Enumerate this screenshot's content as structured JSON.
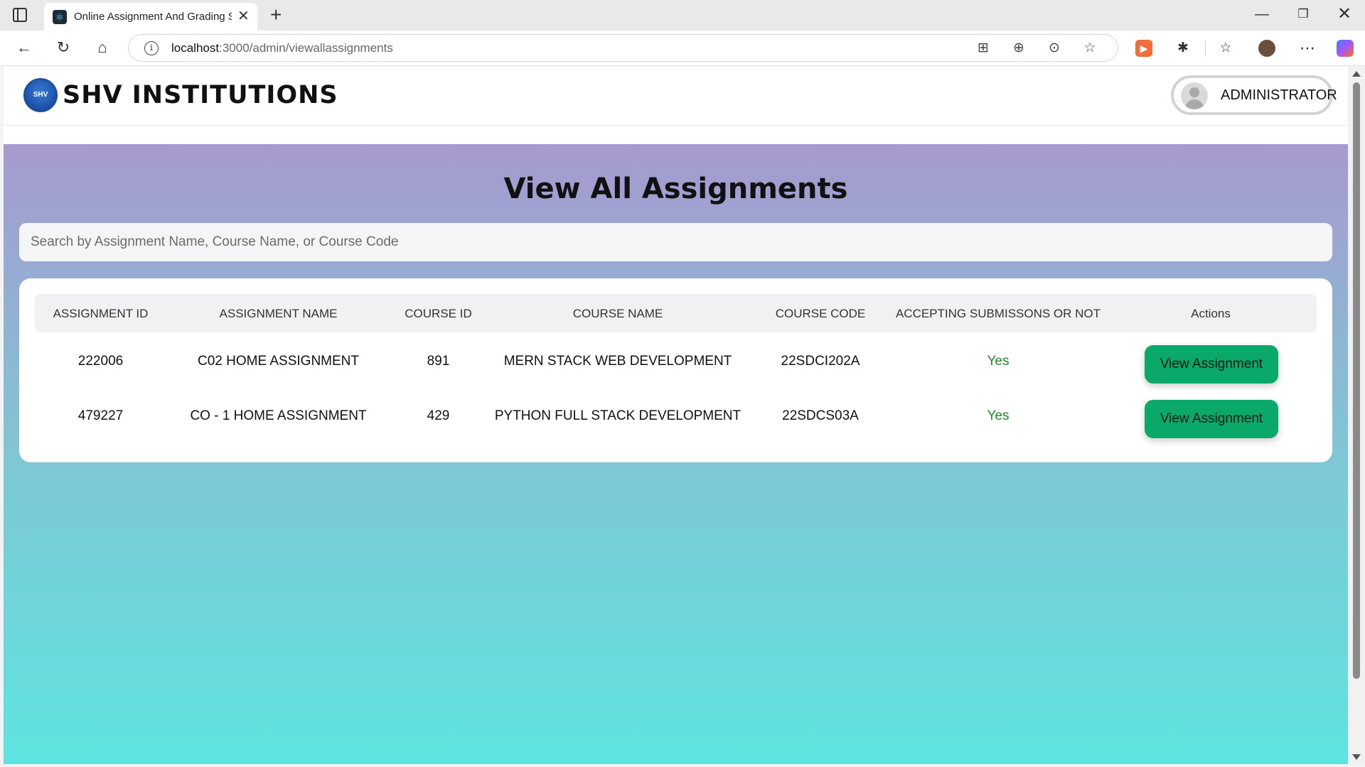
{
  "browser": {
    "tab_title": "Online Assignment And Grading S",
    "url_host": "localhost",
    "url_path": ":3000/admin/viewallassignments"
  },
  "header": {
    "brand": "SHV INSTITUTIONS",
    "logo_text": "SHV",
    "user_role": "ADMINISTRATOR"
  },
  "main": {
    "title": "View All Assignments",
    "search_placeholder": "Search by Assignment Name, Course Name, or Course Code"
  },
  "table": {
    "headers": [
      "ASSIGNMENT ID",
      "ASSIGNMENT NAME",
      "COURSE ID",
      "COURSE NAME",
      "COURSE CODE",
      "ACCEPTING SUBMISSONS OR NOT",
      "Actions"
    ],
    "rows": [
      {
        "assignment_id": "222006",
        "assignment_name": "C02 HOME ASSIGNMENT",
        "course_id": "891",
        "course_name": "MERN STACK WEB DEVELOPMENT",
        "course_code": "22SDCI202A",
        "accepting": "Yes",
        "action": "View Assignment"
      },
      {
        "assignment_id": "479227",
        "assignment_name": "CO - 1 HOME ASSIGNMENT",
        "course_id": "429",
        "course_name": "PYTHON FULL STACK DEVELOPMENT",
        "course_code": "22SDCS03A",
        "accepting": "Yes",
        "action": "View Assignment"
      }
    ]
  },
  "colors": {
    "accent_button": "#0aa869",
    "status_yes": "#1f8a2e",
    "gradient_top": "#a799cf",
    "gradient_bottom": "#5ee4e0"
  }
}
